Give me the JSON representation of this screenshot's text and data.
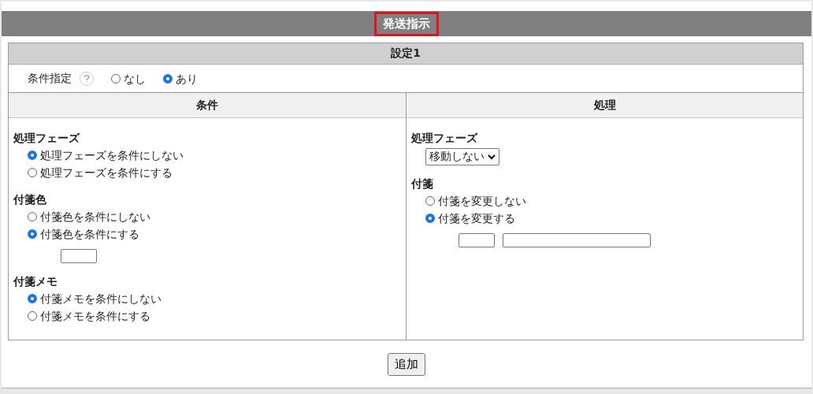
{
  "title": {
    "text": "発送指示",
    "highlighted": true
  },
  "section": {
    "title": "設定1",
    "condition_spec": {
      "label": "条件指定",
      "options": [
        {
          "label": "なし",
          "selected": false
        },
        {
          "label": "あり",
          "selected": true
        }
      ]
    },
    "columns": [
      {
        "heading": "条件",
        "groups": [
          {
            "title": "処理フェーズ",
            "kind": "radio",
            "options": [
              {
                "label": "処理フェーズを条件にしない",
                "selected": true
              },
              {
                "label": "処理フェーズを条件にする",
                "selected": false
              }
            ]
          },
          {
            "title": "付箋色",
            "kind": "radio",
            "options": [
              {
                "label": "付箋色を条件にしない",
                "selected": false
              },
              {
                "label": "付箋色を条件にする",
                "selected": true
              }
            ],
            "fields": [
              {
                "kind": "short"
              }
            ]
          },
          {
            "title": "付箋メモ",
            "kind": "radio",
            "options": [
              {
                "label": "付箋メモを条件にしない",
                "selected": true
              },
              {
                "label": "付箋メモを条件にする",
                "selected": false
              }
            ]
          }
        ]
      },
      {
        "heading": "処理",
        "groups": [
          {
            "title": "処理フェーズ",
            "kind": "select",
            "value": "移動しない"
          },
          {
            "title": "付箋",
            "kind": "radio",
            "options": [
              {
                "label": "付箋を変更しない",
                "selected": false
              },
              {
                "label": "付箋を変更する",
                "selected": true
              }
            ],
            "fields": [
              {
                "kind": "short"
              },
              {
                "kind": "long"
              }
            ]
          }
        ]
      }
    ]
  },
  "add_button": "追加"
}
